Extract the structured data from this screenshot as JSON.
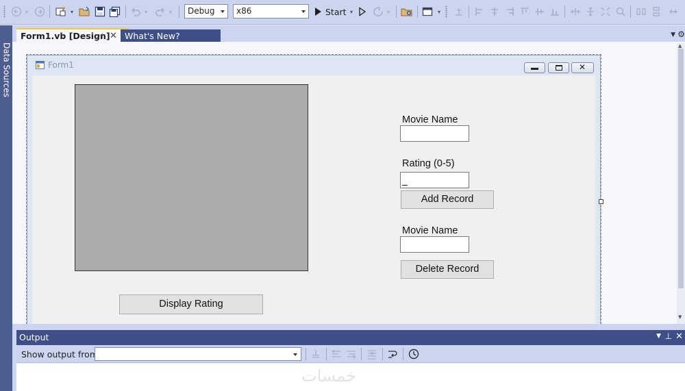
{
  "toolbar": {
    "configuration": "Debug",
    "platform": "x86",
    "start_label": "Start"
  },
  "side_panel": {
    "data_sources_label": "Data Sources"
  },
  "tabs": [
    {
      "label": "Form1.vb [Design]",
      "active": true
    },
    {
      "label": "What's New?",
      "active": false
    }
  ],
  "form": {
    "title": "Form1",
    "labels": {
      "movie_name_1": "Movie Name",
      "rating": "Rating (0-5)",
      "movie_name_2": "Movie Name"
    },
    "inputs": {
      "movie_name_1": "",
      "rating": "_",
      "movie_name_2": ""
    },
    "buttons": {
      "add_record": "Add Record",
      "delete_record": "Delete Record",
      "display_rating": "Display Rating"
    }
  },
  "output": {
    "title": "Output",
    "show_output_from": "Show output from:",
    "source_value": "",
    "watermark": "خمسات"
  },
  "colors": {
    "toolbar_bg": "#ccd5f0",
    "panel_header": "#3d4f86",
    "active_tab_accent": "#f0c93a",
    "picturebox_fill": "#ababab"
  }
}
